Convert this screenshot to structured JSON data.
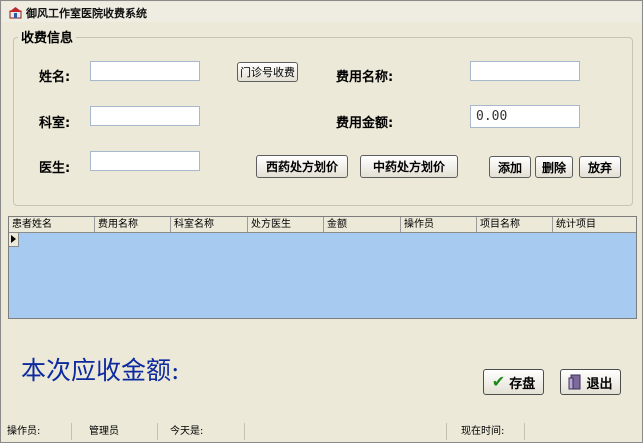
{
  "window": {
    "title": "御风工作室医院收费系统"
  },
  "group": {
    "title": "收费信息"
  },
  "form": {
    "name_label": "姓名:",
    "dept_label": "科室:",
    "doctor_label": "医生:",
    "fee_name_label": "费用名称:",
    "fee_amount_label": "费用金额:",
    "name_value": "",
    "dept_value": "",
    "doctor_value": "",
    "fee_name_value": "",
    "fee_amount_value": "0.00"
  },
  "buttons": {
    "outpatient_fee": "门诊号收费",
    "western_rx": "西药处方划价",
    "chinese_rx": "中药处方划价",
    "add": "添加",
    "delete": "删除",
    "discard": "放弃",
    "save": "存盘",
    "exit": "退出"
  },
  "table": {
    "columns": [
      "患者姓名",
      "费用名称",
      "科室名称",
      "处方医生",
      "金额",
      "操作员",
      "项目名称",
      "统计项目"
    ],
    "rows": []
  },
  "total": {
    "label": "本次应收金额:"
  },
  "status": {
    "operator_label": "操作员:",
    "operator_value": "管理员",
    "today_label": "今天是:",
    "today_value": "",
    "time_label": "现在时间:",
    "time_value": ""
  },
  "icons": {
    "app": "hospital-app-icon",
    "save": "check-icon",
    "exit": "exit-door-icon",
    "row_indicator": "current-row-arrow-icon"
  },
  "colors": {
    "window_bg": "#ece9d8",
    "grid_bg": "#a6caf0",
    "total_text": "#0d2a9e",
    "save_check": "#1b8a1b"
  }
}
